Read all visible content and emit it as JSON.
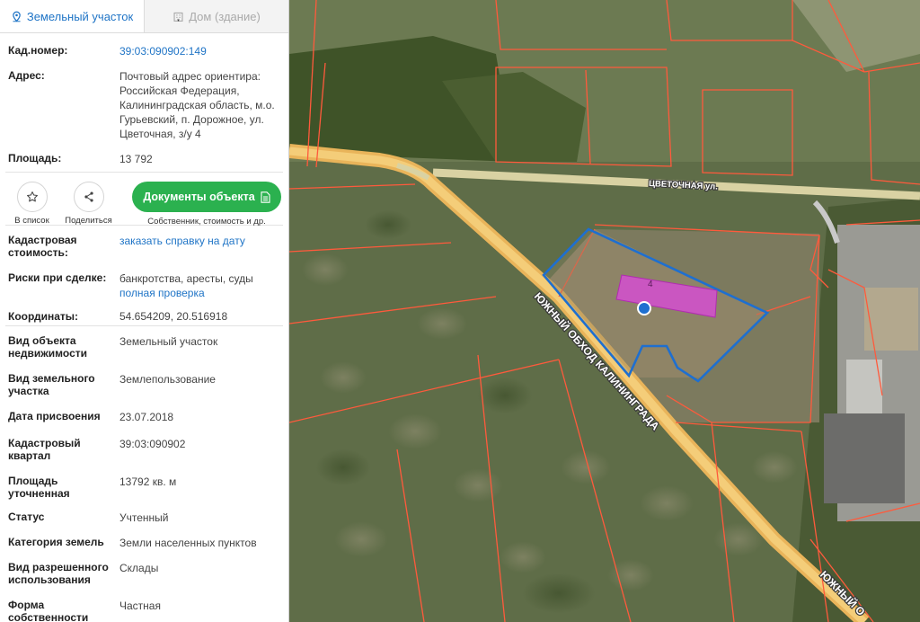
{
  "tabs": [
    {
      "label": "Земельный участок"
    },
    {
      "label": "Дом (здание)"
    }
  ],
  "fields": {
    "cadnum": {
      "label": "Кад.номер:",
      "value": "39:03:090902:149"
    },
    "address": {
      "label": "Адрес:",
      "lines": [
        "Почтовый адрес ориентира:",
        "Российская Федерация,",
        "Калининградская область, м.о.",
        "Гурьевский, п. Дорожное, ул.",
        "Цветочная, з/у 4"
      ]
    },
    "area": {
      "label": "Площадь:",
      "value": "13 792"
    }
  },
  "actions": {
    "favorite": "В список",
    "share": "Поделиться",
    "documents": "Документы объекта",
    "documents_sub": "Собственник, стоимость и др."
  },
  "details": {
    "cadcost": {
      "label_lines": [
        "Кадастровая",
        "стоимость:"
      ],
      "link": "заказать справку на дату"
    },
    "risks": {
      "label": "Риски при сделке:",
      "value": "банкротства, аресты, суды",
      "link": "полная проверка"
    },
    "coords": {
      "label": "Координаты:",
      "value": "54.654209, 20.516918"
    },
    "objtype": {
      "label_lines": [
        "Вид объекта",
        "недвижимости"
      ],
      "value": "Земельный участок"
    },
    "landtype": {
      "label_lines": [
        "Вид земельного",
        "участка"
      ],
      "value": "Землепользование"
    },
    "assigned": {
      "label": "Дата присвоения",
      "value": "23.07.2018"
    },
    "quarter": {
      "label_lines": [
        "Кадастровый",
        "квартал"
      ],
      "value": "39:03:090902"
    },
    "area_precise": {
      "label": "Площадь уточненная",
      "value": "13792 кв. м"
    },
    "status": {
      "label": "Статус",
      "value": "Учтенный"
    },
    "category": {
      "label": "Категория земель",
      "value": "Земли населенных пунктов"
    },
    "permitted_use": {
      "label_lines": [
        "Вид разрешенного",
        "использования"
      ],
      "value": "Склады"
    },
    "ownership": {
      "label_lines": [
        "Форма",
        "собственности"
      ],
      "value": "Частная"
    }
  },
  "map": {
    "street_label": "ЦВЕТОЧНАЯ ул.",
    "road_label": "ЮЖНЫЙ ОБХОД КАЛИНИНГРАДА",
    "road_label_2": "ЮЖНЫЙ О",
    "building_number": "4"
  },
  "colors": {
    "accent": "#1f74c6",
    "button": "#2bb14f",
    "parcel_border": "#ff5a3c",
    "selected_parcel": "#1e6fd0",
    "building": "#d94bd8"
  }
}
